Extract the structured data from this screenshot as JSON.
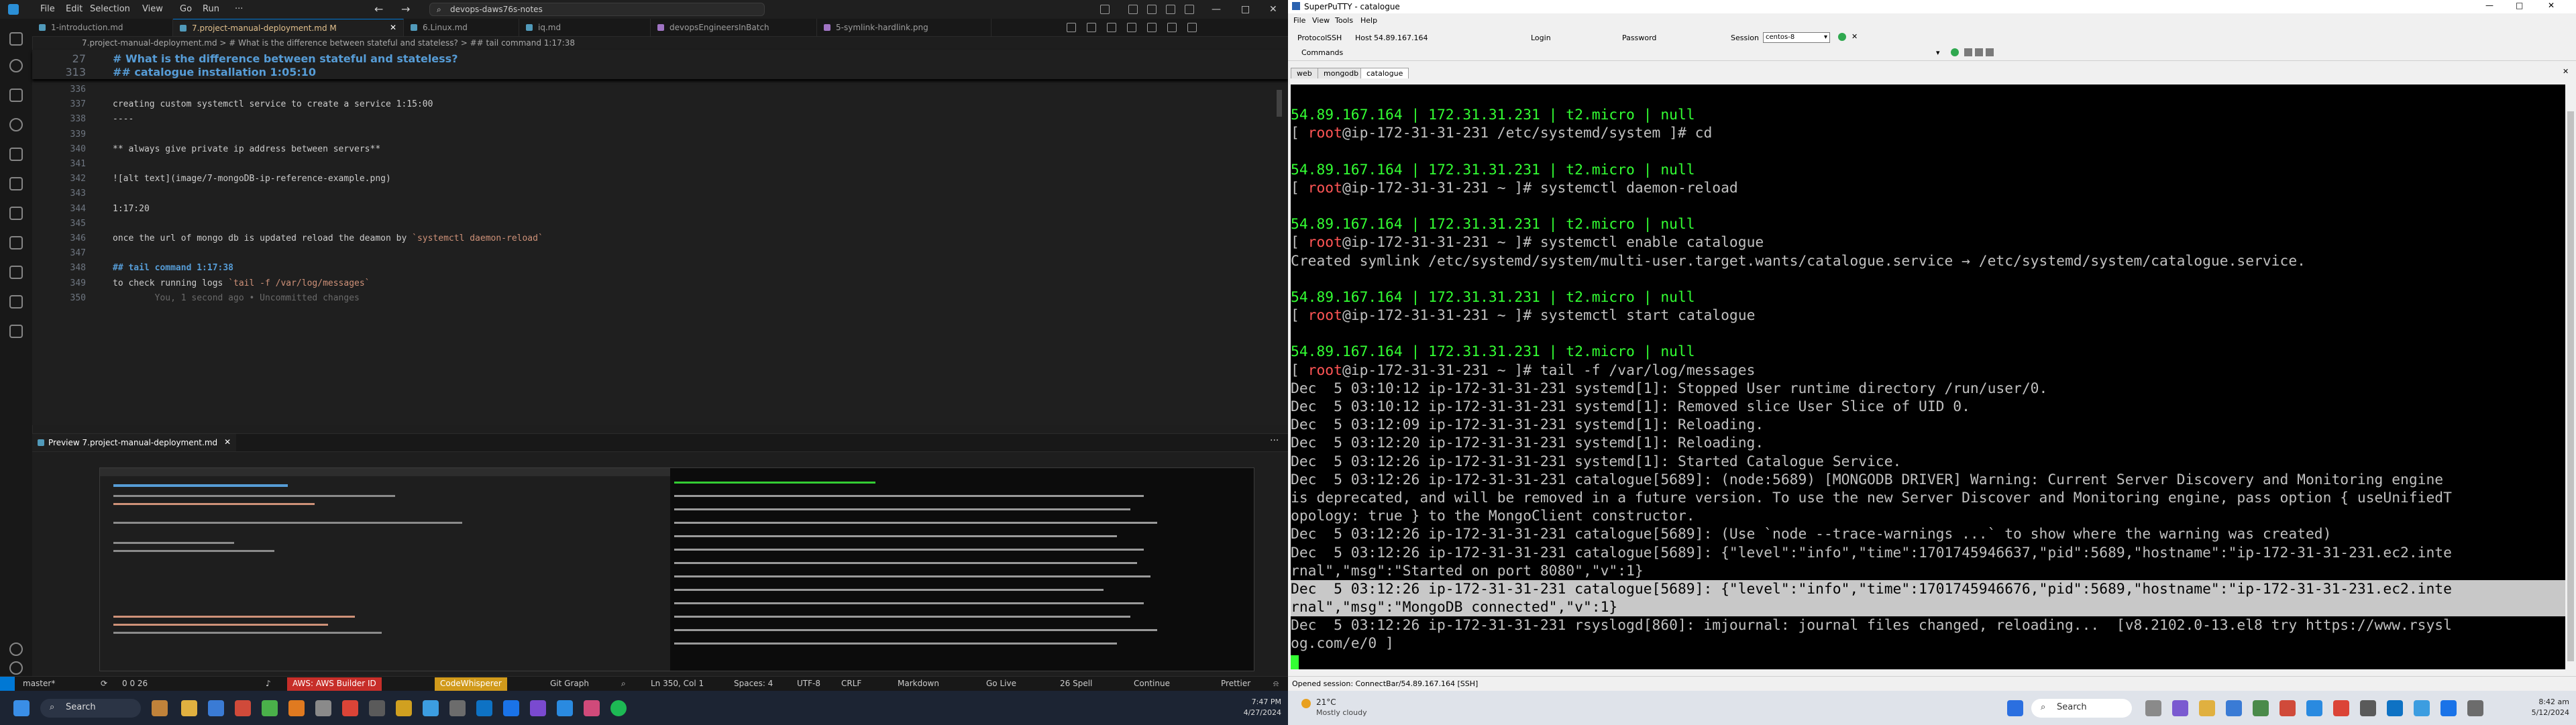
{
  "vscode": {
    "menu": [
      "File",
      "Edit",
      "Selection",
      "View",
      "Go",
      "Run",
      "···"
    ],
    "search": "devops-daws76s-notes",
    "tabs": [
      {
        "label": "1-introduction.md",
        "active": false
      },
      {
        "label": "7.project-manual-deployment.md M",
        "active": true
      },
      {
        "label": "6.Linux.md",
        "active": false
      },
      {
        "label": "iq.md",
        "active": false
      },
      {
        "label": "devopsEngineersInBatch",
        "active": false
      },
      {
        "label": "5-symlink-hardlink.png",
        "active": false
      }
    ],
    "breadcrumb": "7.project-manual-deployment.md > # What is the difference between stateful and stateless? > ## tail command 1:17:38",
    "sticky": [
      {
        "num": "27",
        "text": "# What is the difference between stateful and stateless?"
      },
      {
        "num": "313",
        "text": "## catalogue installation 1:05:10"
      }
    ],
    "lines": [
      {
        "num": "336",
        "text": ""
      },
      {
        "num": "337",
        "text": "creating custom systemctl service to create a service 1:15:00"
      },
      {
        "num": "338",
        "text": "----"
      },
      {
        "num": "339",
        "text": ""
      },
      {
        "num": "340",
        "text": "** always give private ip address between servers**"
      },
      {
        "num": "341",
        "text": ""
      },
      {
        "num": "342",
        "text": "![alt text](image/7-mongoDB-ip-reference-example.png)"
      },
      {
        "num": "343",
        "text": ""
      },
      {
        "num": "344",
        "text": "1:17:20"
      },
      {
        "num": "345",
        "text": ""
      },
      {
        "num": "346",
        "text": "once the url of mongo db is updated reload the deamon by `systemctl daemon-reload`"
      },
      {
        "num": "347",
        "text": ""
      },
      {
        "num": "348",
        "text": "## tail command 1:17:38"
      },
      {
        "num": "349",
        "text": "to check running logs `tail -f /var/log/messages`"
      },
      {
        "num": "350",
        "text": "        You, 1 second ago • Uncommitted changes"
      }
    ],
    "preview_tab": "Preview 7.project-manual-deployment.md",
    "status": {
      "branch": "master*",
      "problems": "0  0  26",
      "aws": "AWS: AWS Builder ID",
      "codewhisperer": "CodeWhisperer",
      "gitgraph": "Git Graph",
      "position": "Ln 350, Col 1",
      "spaces": "Spaces: 4",
      "encoding": "UTF-8",
      "eol": "CRLF",
      "language": "Markdown",
      "golive": "Go Live",
      "spell": "26 Spell",
      "continue": "Continue",
      "prettier": "Prettier"
    }
  },
  "taskbar_left": {
    "search": "Search",
    "time": "7:47 PM",
    "date": "4/27/2024"
  },
  "putty": {
    "title": "SuperPuTTY - catalogue",
    "menu": [
      "File",
      "View",
      "Tools",
      "Help"
    ],
    "toolbar": {
      "protocol_label": "Protocol",
      "protocol": "SSH",
      "host_label": "Host",
      "host": "54.89.167.164",
      "login_label": "Login",
      "password_label": "Password",
      "session_label": "Session",
      "session": "centos-8",
      "commands_label": "Commands"
    },
    "tabs": [
      "web",
      "mongodb",
      "catalogue"
    ],
    "terminal": [
      {
        "t": "54.89.167.164 | 172.31.31.231 | t2.micro | null",
        "c": "g"
      },
      {
        "t": "[ root@ip-172-31-31-231 /etc/systemd/system ]# cd",
        "c": "p"
      },
      {
        "t": "",
        "c": ""
      },
      {
        "t": "54.89.167.164 | 172.31.31.231 | t2.micro | null",
        "c": "g"
      },
      {
        "t": "[ root@ip-172-31-31-231 ~ ]# systemctl daemon-reload",
        "c": "p"
      },
      {
        "t": "",
        "c": ""
      },
      {
        "t": "54.89.167.164 | 172.31.31.231 | t2.micro | null",
        "c": "g"
      },
      {
        "t": "[ root@ip-172-31-31-231 ~ ]# systemctl enable catalogue",
        "c": "p"
      },
      {
        "t": "Created symlink /etc/systemd/system/multi-user.target.wants/catalogue.service → /etc/systemd/system/catalogue.service.",
        "c": ""
      },
      {
        "t": "",
        "c": ""
      },
      {
        "t": "54.89.167.164 | 172.31.31.231 | t2.micro | null",
        "c": "g"
      },
      {
        "t": "[ root@ip-172-31-31-231 ~ ]# systemctl start catalogue",
        "c": "p"
      },
      {
        "t": "",
        "c": ""
      },
      {
        "t": "54.89.167.164 | 172.31.31.231 | t2.micro | null",
        "c": "g"
      },
      {
        "t": "[ root@ip-172-31-31-231 ~ ]# tail -f /var/log/messages",
        "c": "p"
      },
      {
        "t": "Dec  5 03:10:12 ip-172-31-31-231 systemd[1]: Stopped User runtime directory /run/user/0.",
        "c": ""
      },
      {
        "t": "Dec  5 03:10:12 ip-172-31-31-231 systemd[1]: Removed slice User Slice of UID 0.",
        "c": ""
      },
      {
        "t": "Dec  5 03:12:09 ip-172-31-31-231 systemd[1]: Reloading.",
        "c": ""
      },
      {
        "t": "Dec  5 03:12:20 ip-172-31-31-231 systemd[1]: Reloading.",
        "c": ""
      },
      {
        "t": "Dec  5 03:12:26 ip-172-31-31-231 systemd[1]: Started Catalogue Service.",
        "c": ""
      },
      {
        "t": "Dec  5 03:12:26 ip-172-31-31-231 catalogue[5689]: (node:5689) [MONGODB DRIVER] Warning: Current Server Discovery and Monitoring engine",
        "c": ""
      },
      {
        "t": "is deprecated, and will be removed in a future version. To use the new Server Discover and Monitoring engine, pass option { useUnifiedT",
        "c": ""
      },
      {
        "t": "opology: true } to the MongoClient constructor.",
        "c": ""
      },
      {
        "t": "Dec  5 03:12:26 ip-172-31-31-231 catalogue[5689]: (Use `node --trace-warnings ...` to show where the warning was created)",
        "c": ""
      },
      {
        "t": "Dec  5 03:12:26 ip-172-31-31-231 catalogue[5689]: {\"level\":\"info\",\"time\":1701745946637,\"pid\":5689,\"hostname\":\"ip-172-31-31-231.ec2.inte",
        "c": ""
      },
      {
        "t": "rnal\",\"msg\":\"Started on port 8080\",\"v\":1}",
        "c": ""
      },
      {
        "t": "Dec  5 03:12:26 ip-172-31-31-231 catalogue[5689]: {\"level\":\"info\",\"time\":1701745946676,\"pid\":5689,\"hostname\":\"ip-172-31-31-231.ec2.inte",
        "c": "h1"
      },
      {
        "t": "rnal\",\"msg\":\"MongoDB connected\",\"v\":1}",
        "c": "h"
      },
      {
        "t": "Dec  5 03:12:26 ip-172-31-31-231 rsyslogd[860]: imjournal: journal files changed, reloading...  [v8.2102.0-13.el8 try https://www.rsysl",
        "c": ""
      },
      {
        "t": "og.com/e/0 ]",
        "c": ""
      }
    ],
    "status": "Opened session: ConnectBar/54.89.167.164 [SSH]"
  },
  "taskbar_right": {
    "weather": "21°C",
    "weather_sub": "Mostly cloudy",
    "search": "Search",
    "time": "8:42 am",
    "date": "5/12/2024"
  }
}
